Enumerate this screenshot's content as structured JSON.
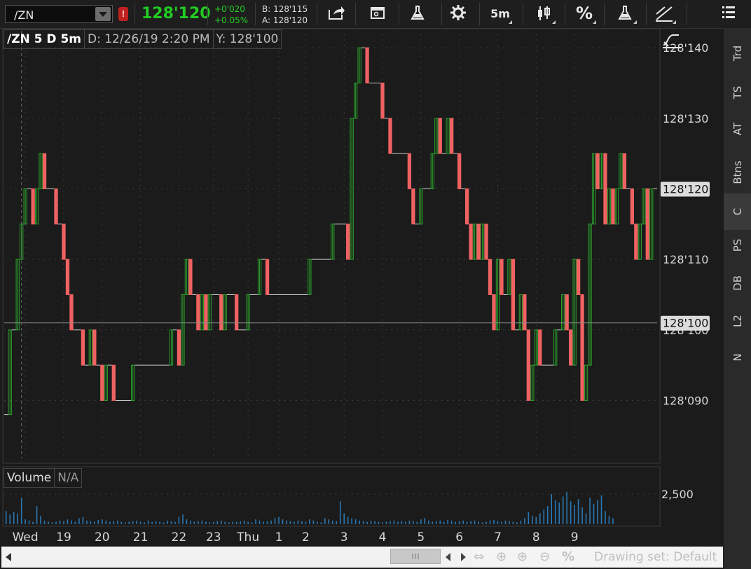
{
  "toolbar": {
    "symbol": "/ZN",
    "alert_badge": "!",
    "last_price": "128'120",
    "net_change": "+0'020",
    "pct_change": "+0.05%",
    "bid": "B: 128'115",
    "ask": "A: 128'120",
    "buttons": [
      {
        "name": "share-icon"
      },
      {
        "name": "studies-panel-icon"
      },
      {
        "name": "flask-icon"
      },
      {
        "name": "settings-gear-icon"
      },
      {
        "name": "timeframe-button",
        "label": "5m"
      },
      {
        "name": "chart-style-candles-icon"
      },
      {
        "name": "percent-icon",
        "label": "%"
      },
      {
        "name": "flask-icon-2"
      },
      {
        "name": "drawing-tools-icon"
      },
      {
        "name": "menu-icon"
      }
    ]
  },
  "chart_header": {
    "title": "/ZN 5 D 5m",
    "date": "D: 12/26/19 2:20 PM",
    "y_value": "Y: 128'100"
  },
  "volume_header": {
    "label": "Volume",
    "value": "N/A"
  },
  "chart_data": {
    "type": "candlestick",
    "symbol": "/ZN",
    "timeframe": "5 D 5m",
    "y_ticks": [
      "128'090",
      "128'100",
      "128'110",
      "128'120",
      "128'130",
      "128'140"
    ],
    "y_tick_values": [
      128.09,
      128.1,
      128.11,
      128.12,
      128.13,
      128.14
    ],
    "y_range": [
      128.082,
      128.142
    ],
    "current_price_label": "128'120",
    "current_price": 128.12,
    "crosshair_price_label": "128'100",
    "crosshair_price": 128.101,
    "x_labels": [
      "Wed",
      "19",
      "20",
      "21",
      "22",
      "23",
      "Thu",
      "1",
      "2",
      "3",
      "4",
      "5",
      "6",
      "7",
      "8",
      "9"
    ],
    "x_label_index": [
      5,
      15,
      25,
      35,
      45,
      54,
      63,
      71,
      78,
      88,
      98,
      108,
      118,
      128,
      138,
      148
    ],
    "volume_tick_label": "2,500",
    "volume_tick_value": 2500,
    "colors": {
      "up": "#2ca02c",
      "down": "#f06262",
      "flat": "#cccccc",
      "background": "#1b1b1b",
      "grid": "#3a3a3a"
    },
    "price_path": [
      128.088,
      128.1,
      128.1,
      128.11,
      128.115,
      128.12,
      128.12,
      128.115,
      128.12,
      128.125,
      128.12,
      128.12,
      128.12,
      128.115,
      128.115,
      128.11,
      128.105,
      128.1,
      128.1,
      128.1,
      128.095,
      128.095,
      128.1,
      128.095,
      128.095,
      128.09,
      128.095,
      128.095,
      128.09,
      128.09,
      128.09,
      128.09,
      128.09,
      128.095,
      128.095,
      128.095,
      128.095,
      128.095,
      128.095,
      128.095,
      128.095,
      128.095,
      128.095,
      128.1,
      128.1,
      128.095,
      128.105,
      128.11,
      128.105,
      128.105,
      128.1,
      128.105,
      128.1,
      128.105,
      128.105,
      128.105,
      128.1,
      128.105,
      128.105,
      128.105,
      128.1,
      128.1,
      128.1,
      128.105,
      128.105,
      128.105,
      128.11,
      128.11,
      128.105,
      128.105,
      128.105,
      128.105,
      128.105,
      128.105,
      128.105,
      128.105,
      128.105,
      128.105,
      128.105,
      128.11,
      128.11,
      128.11,
      128.11,
      128.11,
      128.11,
      128.115,
      128.115,
      128.115,
      128.115,
      128.11,
      128.13,
      128.135,
      128.14,
      128.14,
      128.135,
      128.135,
      128.135,
      128.135,
      128.13,
      128.13,
      128.125,
      128.125,
      128.125,
      128.125,
      128.125,
      128.12,
      128.115,
      128.115,
      128.12,
      128.12,
      128.12,
      128.125,
      128.13,
      128.125,
      128.125,
      128.13,
      128.125,
      128.125,
      128.12,
      128.12,
      128.115,
      128.11,
      128.115,
      128.11,
      128.115,
      128.11,
      128.105,
      128.1,
      128.11,
      128.105,
      128.105,
      128.11,
      128.1,
      128.1,
      128.105,
      128.1,
      128.09,
      128.095,
      128.1,
      128.095,
      128.095,
      128.095,
      128.095,
      128.1,
      128.1,
      128.105,
      128.1,
      128.095,
      128.11,
      128.105,
      128.09,
      128.095,
      128.115,
      128.125,
      128.12,
      128.125,
      128.115,
      128.12,
      128.115,
      128.12,
      128.125,
      128.12,
      128.12,
      128.115,
      128.11,
      128.115,
      128.12,
      128.11,
      128.12,
      128.12
    ],
    "volume": [
      1100,
      800,
      1000,
      900,
      2200,
      400,
      300,
      200,
      1500,
      700,
      300,
      200,
      150,
      200,
      300,
      250,
      400,
      300,
      200,
      500,
      600,
      300,
      250,
      200,
      350,
      400,
      300,
      200,
      250,
      300,
      200,
      150,
      200,
      250,
      300,
      200,
      150,
      300,
      200,
      250,
      200,
      150,
      300,
      250,
      200,
      600,
      800,
      400,
      300,
      200,
      250,
      300,
      200,
      150,
      200,
      250,
      300,
      200,
      150,
      200,
      200,
      250,
      300,
      200,
      150,
      400,
      300,
      200,
      250,
      300,
      500,
      600,
      400,
      300,
      250,
      200,
      300,
      250,
      200,
      400,
      300,
      200,
      150,
      500,
      400,
      300,
      250,
      1900,
      900,
      600,
      500,
      400,
      300,
      250,
      200,
      300,
      250,
      200,
      150,
      200,
      250,
      300,
      200,
      250,
      200,
      300,
      250,
      200,
      400,
      500,
      300,
      200,
      250,
      300,
      200,
      350,
      300,
      200,
      250,
      300,
      200,
      250,
      300,
      200,
      150,
      200,
      300,
      350,
      250,
      200,
      300,
      250,
      200,
      150,
      300,
      500,
      1000,
      700,
      600,
      900,
      1200,
      1500,
      2500,
      2000,
      1800,
      2300,
      2700,
      1900,
      1600,
      2100,
      1400,
      900,
      2200,
      1700,
      2000,
      2400,
      1100,
      700,
      500
    ]
  }
}
